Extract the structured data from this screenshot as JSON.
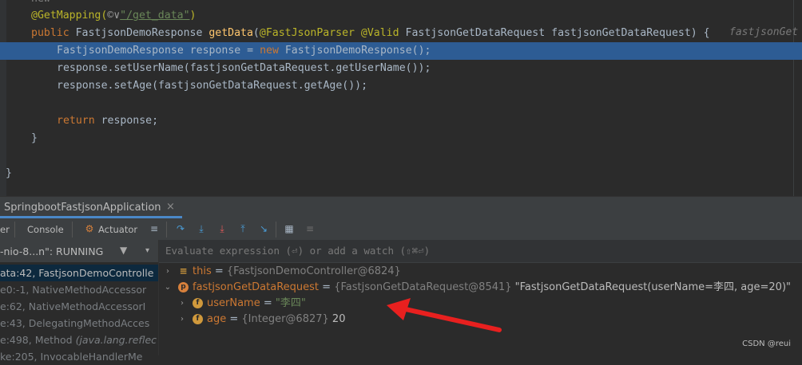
{
  "editor": {
    "line0_partial": "new",
    "lines": [
      {
        "ann": "@GetMapping(",
        "icon": "©∨",
        "str": "\"/get_data\"",
        "close": ")"
      },
      {
        "kw": "public",
        "type": "FastjsonDemoResponse",
        "fn": "getData",
        "p1": "(",
        "ann1": "@FastJsonParser",
        "ann2": "@Valid",
        "rest": "FastjsonGetDataRequest fastjsonGetDataRequest) {"
      },
      {
        "a": "FastjsonDemoResponse response = ",
        "kw": "new",
        "b": " FastjsonDemoResponse();"
      },
      {
        "text": "response.setUserName(fastjsonGetDataRequest.getUserName());"
      },
      {
        "text": "response.setAge(fastjsonGetDataRequest.getAge());"
      },
      {
        "kw": "return",
        "b": " response;"
      },
      {
        "text": "}"
      },
      {
        "text": "}"
      }
    ],
    "inlay_hint": "fastjsonGet"
  },
  "debug_panel": {
    "title": "SpringbootFastjsonApplication",
    "close_glyph": "×",
    "tabs": [
      "er",
      "Console",
      "Actuator"
    ],
    "thread": {
      "name": "-nio-8...n\": RUNNING"
    },
    "frames": [
      {
        "text": "ata:42, FastjsonDemoControlle",
        "selected": true
      },
      {
        "text": "e0:-1, NativeMethodAccessor"
      },
      {
        "text": "e:62, NativeMethodAccessorI"
      },
      {
        "text": "e:43, DelegatingMethodAcces"
      },
      {
        "text": "e:498, Method",
        "italic": "(java.lang.reflec"
      },
      {
        "text": "ke:205, InvocableHandlerMe"
      }
    ],
    "evaluate_placeholder": "Evaluate expression (⏎) or add a watch (⇧⌘⏎)",
    "variables": [
      {
        "name": "this",
        "ref": "{FastjsonDemoController@6824}",
        "value": "",
        "expanded": false,
        "icon": "stack"
      },
      {
        "name": "fastjsonGetDataRequest",
        "ref": "{FastjsonGetDataRequest@8541}",
        "value": "\"FastjsonGetDataRequest(userName=李四, age=20)\"",
        "expanded": true,
        "icon": "p"
      },
      {
        "name": "userName",
        "ref": "",
        "value": "\"李四\"",
        "expanded": false,
        "icon": "f"
      },
      {
        "name": "age",
        "ref": "{Integer@6827}",
        "value": "20",
        "expanded": false,
        "icon": "f"
      }
    ],
    "icon_letters": {
      "f": "f",
      "p": "p",
      "stack": "≡"
    },
    "equals": " = ",
    "twisty_collapsed": "›",
    "twisty_expanded": "⌄"
  },
  "watermark": "CSDN @reui",
  "colors": {
    "arrow": "#e8201f",
    "highlight": "#2d5c94"
  }
}
